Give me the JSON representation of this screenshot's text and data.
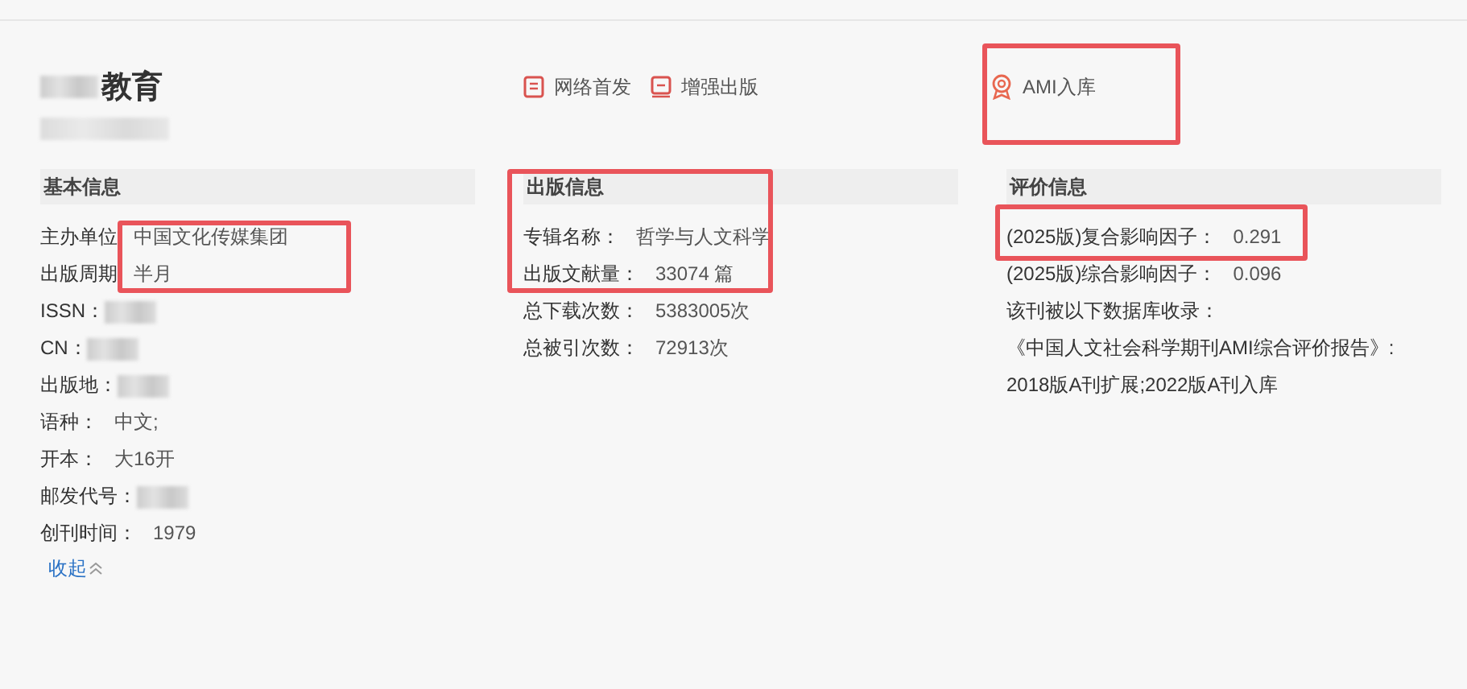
{
  "journal": {
    "title": "教育",
    "tags": [
      {
        "kind": "web",
        "label": "网络首发"
      },
      {
        "kind": "enhanced",
        "label": "增强出版"
      },
      {
        "kind": "ami",
        "label": "AMI入库"
      }
    ]
  },
  "sections": [
    {
      "heading": "基本信息",
      "rows": [
        {
          "label": "主办单位",
          "value": "中国文化传媒集团"
        },
        {
          "label": "出版周期",
          "value": "半月"
        },
        {
          "label": "ISSN：",
          "redacted": true
        },
        {
          "label": "CN：",
          "redacted": true
        },
        {
          "label": "出版地：",
          "redacted": true
        },
        {
          "label": "语种：",
          "value": "中文;"
        },
        {
          "label": "开本：",
          "value": "大16开"
        },
        {
          "label": "邮发代号：",
          "redacted": true
        },
        {
          "label": "创刊时间：",
          "value": "1979"
        }
      ],
      "toggle": "收起"
    },
    {
      "heading": "出版信息",
      "rows": [
        {
          "label": "专辑名称：",
          "value": "哲学与人文科学"
        },
        {
          "label": "出版文献量：",
          "value": "33074 篇"
        },
        {
          "label": "总下载次数：",
          "value": "5383005次"
        },
        {
          "label": "总被引次数：",
          "value": "72913次"
        }
      ]
    },
    {
      "heading": "评价信息",
      "rows": [
        {
          "label": "(2025版)复合影响因子：",
          "value": "0.291"
        },
        {
          "label": "(2025版)综合影响因子：",
          "value": "0.096"
        },
        {
          "label": "该刊被以下数据库收录："
        },
        {
          "label": "《中国人文社会科学期刊AMI综合评价报告》:"
        },
        {
          "label": "2018版A刊扩展;2022版A刊入库"
        }
      ]
    }
  ]
}
